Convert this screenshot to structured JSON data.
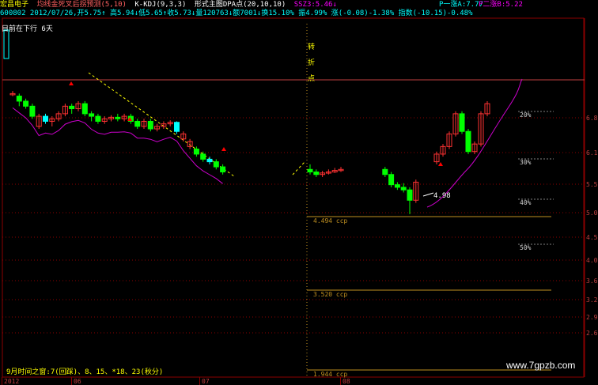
{
  "header": {
    "title": "宏昌电子",
    "indicator_name": "均线金死叉后拐预测(5,10)",
    "indicator2": "K-KDJ(9,3,3)",
    "indicator3": "形式主图DPA点(20,10,10)",
    "ssz": "SSZ3:5.46↓",
    "p_one": "P一涨A:7.77",
    "p_two": "P二涨B:5.22",
    "info_line": "600802  2012/07/26,开5.75↑  高5.94↓低5.65↑收5.73↓量120763↓额7001↓换15.10%  振4.99%  涨(-0.08)-1.38%  指数(-10.15)-0.48%"
  },
  "annotations": {
    "trend_label": "目前在下行 6天",
    "turn_point": "转折点",
    "time_note": "9月时间之窗:7(回踩)、8、15、*18、23(秋分)",
    "low_price": "4.98",
    "watermark": "www.7gpzb.com"
  },
  "colors": {
    "background": "#000000",
    "up": "#ff3232",
    "down": "#00ff00",
    "down_alt": "#00ffff",
    "ma_line": "#cc00cc",
    "axis": "#8b0000",
    "grid_dot": "#8b0000",
    "level_line": "#c09020",
    "text_yellow": "#ffff00",
    "text_white": "#ffffff"
  },
  "chart_data": {
    "type": "candlestick",
    "y_axis_ticks": [
      "6.87",
      "6.18",
      "5.56",
      "5.01",
      "4.51",
      "4.05",
      "3.65",
      "3.28",
      "2.96",
      "2.66"
    ],
    "x_axis_labels": [
      "2012",
      "06",
      "07",
      "08"
    ],
    "percent_levels": [
      "20%",
      "30%",
      "40%",
      "50%"
    ],
    "support_levels": [
      {
        "price": 4.494,
        "label": "4.494 ccp"
      },
      {
        "price": 3.52,
        "label": "3.520 ccp"
      },
      {
        "price": 1.944,
        "label": "1.944 ccp"
      }
    ],
    "candles": [
      {
        "o": 7.35,
        "c": 7.35,
        "h": 7.4,
        "l": 7.3
      },
      {
        "o": 7.3,
        "c": 7.2,
        "h": 7.35,
        "l": 7.1
      },
      {
        "o": 7.2,
        "c": 7.1,
        "h": 7.25,
        "l": 7.05
      },
      {
        "o": 7.1,
        "c": 6.9,
        "h": 7.15,
        "l": 6.85
      },
      {
        "o": 6.7,
        "c": 6.9,
        "h": 6.95,
        "l": 6.65
      },
      {
        "o": 6.9,
        "c": 6.8,
        "h": 6.95,
        "l": 6.75
      },
      {
        "o": 6.8,
        "c": 6.85,
        "h": 6.9,
        "l": 6.7
      },
      {
        "o": 6.85,
        "c": 6.95,
        "h": 7.0,
        "l": 6.8
      },
      {
        "o": 6.95,
        "c": 7.1,
        "h": 7.15,
        "l": 6.9
      },
      {
        "o": 7.1,
        "c": 7.05,
        "h": 7.15,
        "l": 6.95
      },
      {
        "o": 7.05,
        "c": 7.15,
        "h": 7.2,
        "l": 7.0
      },
      {
        "o": 7.15,
        "c": 6.95,
        "h": 7.2,
        "l": 6.9
      },
      {
        "o": 6.95,
        "c": 6.9,
        "h": 7.0,
        "l": 6.8
      },
      {
        "o": 6.9,
        "c": 6.8,
        "h": 6.95,
        "l": 6.75
      },
      {
        "o": 6.8,
        "c": 6.85,
        "h": 6.9,
        "l": 6.75
      },
      {
        "o": 6.85,
        "c": 6.88,
        "h": 6.92,
        "l": 6.8
      },
      {
        "o": 6.88,
        "c": 6.85,
        "h": 6.95,
        "l": 6.8
      },
      {
        "o": 6.85,
        "c": 6.9,
        "h": 6.95,
        "l": 6.8
      },
      {
        "o": 6.9,
        "c": 6.8,
        "h": 6.95,
        "l": 6.75
      },
      {
        "o": 6.8,
        "c": 6.7,
        "h": 6.85,
        "l": 6.65
      },
      {
        "o": 6.7,
        "c": 6.8,
        "h": 6.85,
        "l": 6.65
      },
      {
        "o": 6.8,
        "c": 6.65,
        "h": 6.85,
        "l": 6.6
      },
      {
        "o": 6.65,
        "c": 6.7,
        "h": 6.75,
        "l": 6.6
      },
      {
        "o": 6.7,
        "c": 6.75,
        "h": 6.8,
        "l": 6.65
      },
      {
        "o": 6.75,
        "c": 6.78,
        "h": 6.82,
        "l": 6.7
      },
      {
        "o": 6.78,
        "c": 6.6,
        "h": 6.8,
        "l": 6.55
      },
      {
        "o": 6.45,
        "c": 6.55,
        "h": 6.6,
        "l": 6.4
      },
      {
        "o": 6.3,
        "c": 6.4,
        "h": 6.45,
        "l": 6.25
      },
      {
        "o": 6.25,
        "c": 6.15,
        "h": 6.3,
        "l": 6.1
      },
      {
        "o": 6.15,
        "c": 6.05,
        "h": 6.2,
        "l": 6.0
      },
      {
        "o": 6.05,
        "c": 6.0,
        "h": 6.1,
        "l": 5.95
      },
      {
        "o": 6.0,
        "c": 5.9,
        "h": 6.05,
        "l": 5.85
      },
      {
        "o": 5.9,
        "c": 5.8,
        "h": 5.95,
        "l": 5.75
      }
    ],
    "candles2": [
      {
        "o": 5.85,
        "c": 5.8,
        "h": 5.95,
        "l": 5.75
      },
      {
        "o": 5.8,
        "c": 5.75,
        "h": 5.85,
        "l": 5.7
      },
      {
        "o": 5.75,
        "c": 5.78,
        "h": 5.82,
        "l": 5.7
      },
      {
        "o": 5.78,
        "c": 5.8,
        "h": 5.85,
        "l": 5.75
      },
      {
        "o": 5.8,
        "c": 5.83,
        "h": 5.88,
        "l": 5.78
      },
      {
        "o": 5.83,
        "c": 5.85,
        "h": 5.9,
        "l": 5.8
      },
      {
        "o": 5.85,
        "c": 5.75,
        "h": 5.9,
        "l": 5.7
      },
      {
        "o": 5.75,
        "c": 5.55,
        "h": 5.8,
        "l": 5.5
      },
      {
        "o": 5.55,
        "c": 5.5,
        "h": 5.6,
        "l": 5.45
      },
      {
        "o": 5.5,
        "c": 5.45,
        "h": 5.58,
        "l": 5.4
      },
      {
        "o": 5.45,
        "c": 5.25,
        "h": 5.5,
        "l": 4.98
      },
      {
        "o": 5.25,
        "c": 5.6,
        "h": 5.65,
        "l": 5.2
      },
      {
        "o": 6.0,
        "c": 6.15,
        "h": 6.2,
        "l": 5.95
      },
      {
        "o": 6.15,
        "c": 6.3,
        "h": 6.35,
        "l": 6.1
      },
      {
        "o": 6.3,
        "c": 6.55,
        "h": 6.6,
        "l": 6.25
      },
      {
        "o": 6.55,
        "c": 6.95,
        "h": 7.0,
        "l": 6.5
      },
      {
        "o": 6.95,
        "c": 6.6,
        "h": 7.0,
        "l": 6.55
      },
      {
        "o": 6.6,
        "c": 6.2,
        "h": 6.65,
        "l": 6.15
      },
      {
        "o": 6.2,
        "c": 6.35,
        "h": 6.4,
        "l": 6.15
      },
      {
        "o": 6.35,
        "c": 6.95,
        "h": 7.0,
        "l": 6.3
      },
      {
        "o": 6.95,
        "c": 7.15,
        "h": 7.2,
        "l": 6.9
      }
    ]
  }
}
